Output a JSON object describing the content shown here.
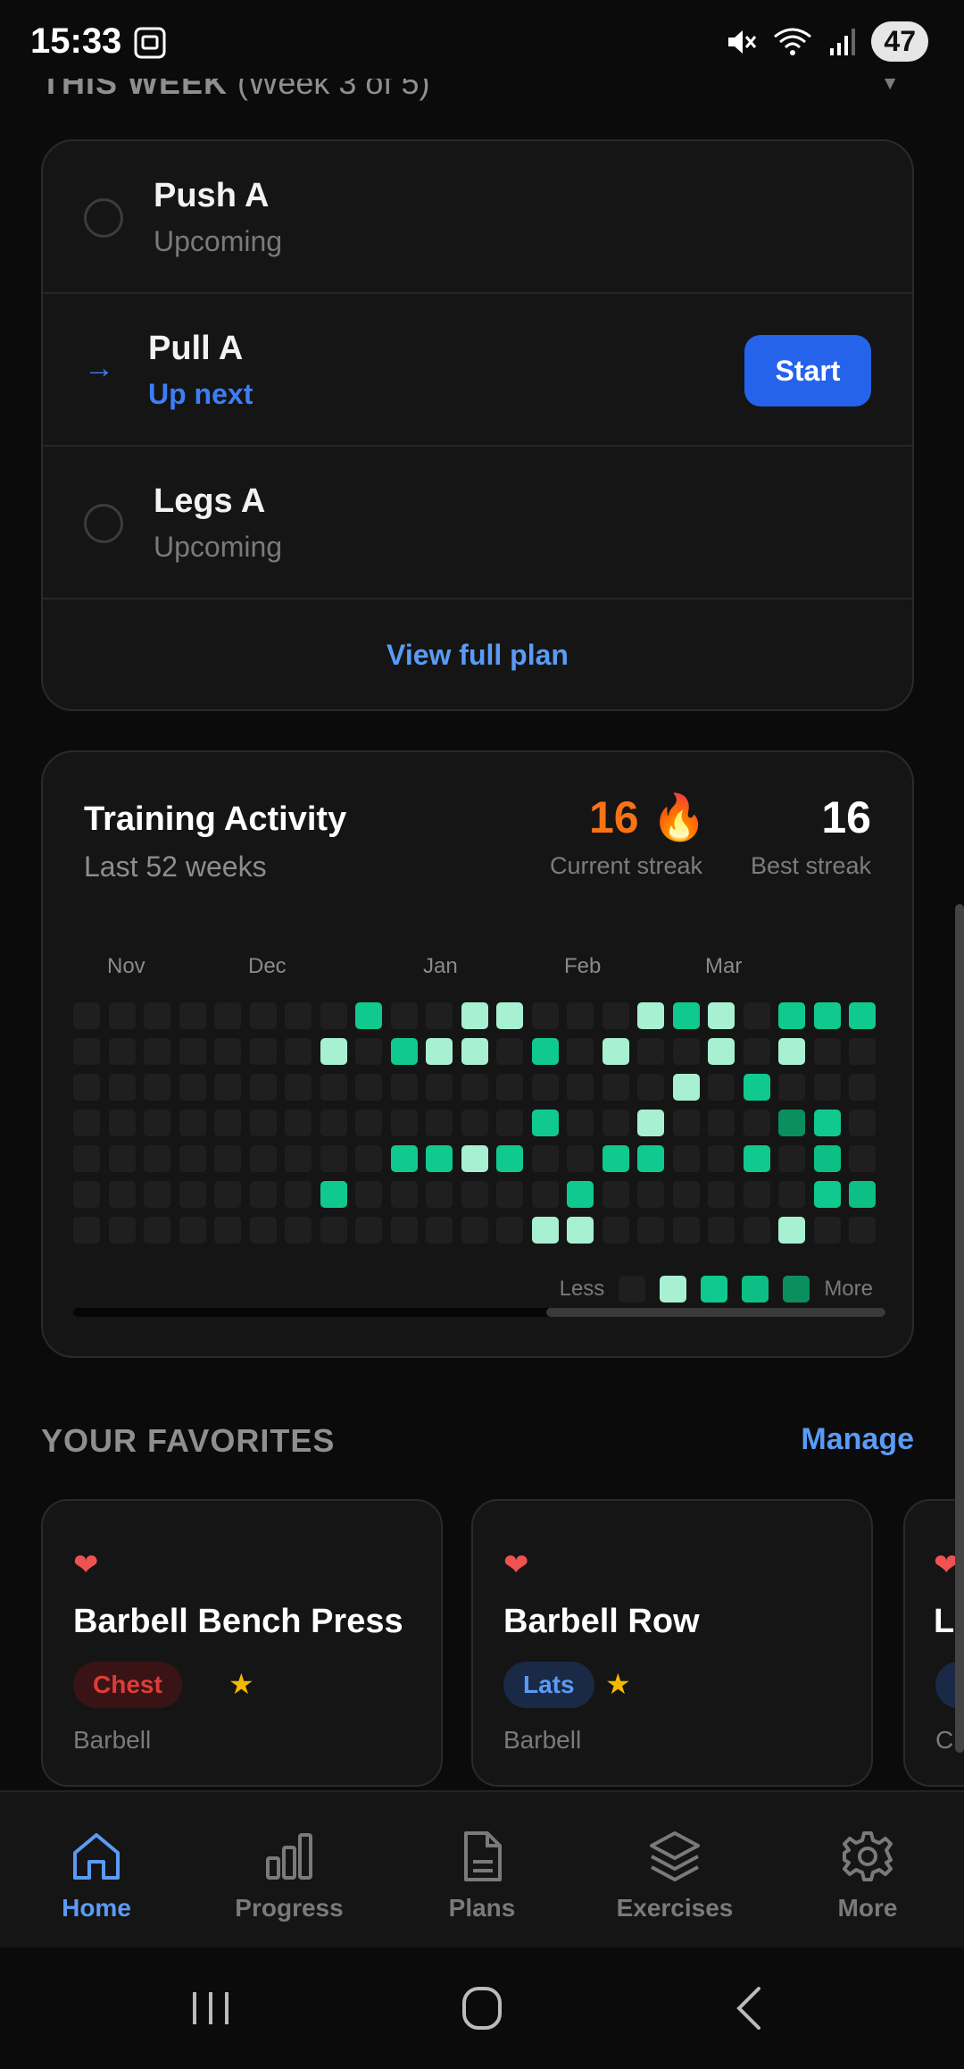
{
  "status_bar": {
    "time": "15:33",
    "battery": "47"
  },
  "week": {
    "title": "THIS WEEK",
    "subtitle": "(Week 3 of 5)"
  },
  "plan": {
    "rows": [
      {
        "title": "Push A",
        "status": "Upcoming"
      },
      {
        "title": "Pull A",
        "status": "Up next",
        "action": "Start"
      },
      {
        "title": "Legs A",
        "status": "Upcoming"
      }
    ],
    "view_full": "View full plan"
  },
  "activity": {
    "title": "Training Activity",
    "subtitle": "Last 52 weeks",
    "current_streak": "16",
    "current_streak_emoji": "🔥",
    "current_label": "Current streak",
    "best_streak": "16",
    "best_label": "Best streak",
    "months": [
      "Nov",
      "Dec",
      "Jan",
      "Feb",
      "Mar"
    ],
    "legend_less": "Less",
    "legend_more": "More",
    "colors": {
      "empty": "#1f1f1f",
      "l1": "#a7f0d1",
      "l2": "#10c98f",
      "l3": "#0cbf85",
      "l4": "#0b8f5f"
    },
    "heatmap": {
      "columns": 23,
      "rows": 7,
      "active": [
        {
          "col": 8,
          "row": 0,
          "level": 2
        },
        {
          "col": 11,
          "row": 0,
          "level": 1
        },
        {
          "col": 12,
          "row": 0,
          "level": 1
        },
        {
          "col": 16,
          "row": 0,
          "level": 1
        },
        {
          "col": 17,
          "row": 0,
          "level": 2
        },
        {
          "col": 18,
          "row": 0,
          "level": 1
        },
        {
          "col": 20,
          "row": 0,
          "level": 2
        },
        {
          "col": 21,
          "row": 0,
          "level": 2
        },
        {
          "col": 22,
          "row": 0,
          "level": 2
        },
        {
          "col": 7,
          "row": 1,
          "level": 1
        },
        {
          "col": 9,
          "row": 1,
          "level": 2
        },
        {
          "col": 10,
          "row": 1,
          "level": 1
        },
        {
          "col": 11,
          "row": 1,
          "level": 1
        },
        {
          "col": 13,
          "row": 1,
          "level": 2
        },
        {
          "col": 15,
          "row": 1,
          "level": 1
        },
        {
          "col": 18,
          "row": 1,
          "level": 1
        },
        {
          "col": 20,
          "row": 1,
          "level": 1
        },
        {
          "col": 17,
          "row": 2,
          "level": 1
        },
        {
          "col": 19,
          "row": 2,
          "level": 2
        },
        {
          "col": 13,
          "row": 3,
          "level": 2
        },
        {
          "col": 16,
          "row": 3,
          "level": 1
        },
        {
          "col": 20,
          "row": 3,
          "level": 4
        },
        {
          "col": 21,
          "row": 3,
          "level": 2
        },
        {
          "col": 9,
          "row": 4,
          "level": 2
        },
        {
          "col": 10,
          "row": 4,
          "level": 2
        },
        {
          "col": 11,
          "row": 4,
          "level": 1
        },
        {
          "col": 12,
          "row": 4,
          "level": 2
        },
        {
          "col": 15,
          "row": 4,
          "level": 2
        },
        {
          "col": 16,
          "row": 4,
          "level": 2
        },
        {
          "col": 19,
          "row": 4,
          "level": 2
        },
        {
          "col": 21,
          "row": 4,
          "level": 3
        },
        {
          "col": 7,
          "row": 5,
          "level": 2
        },
        {
          "col": 14,
          "row": 5,
          "level": 2
        },
        {
          "col": 21,
          "row": 5,
          "level": 2
        },
        {
          "col": 22,
          "row": 5,
          "level": 3
        },
        {
          "col": 13,
          "row": 6,
          "level": 1
        },
        {
          "col": 14,
          "row": 6,
          "level": 1
        },
        {
          "col": 20,
          "row": 6,
          "level": 1
        }
      ]
    }
  },
  "favorites": {
    "title": "YOUR FAVORITES",
    "manage": "Manage",
    "items": [
      {
        "name": "Barbell Bench Press",
        "tag": "Chest",
        "equipment": "Barbell"
      },
      {
        "name": "Barbell Row",
        "tag": "Lats",
        "equipment": "Barbell"
      },
      {
        "name": "L",
        "tag": "",
        "equipment": "C"
      }
    ]
  },
  "nav": {
    "items": [
      {
        "label": "Home",
        "icon": "home-icon",
        "active": true
      },
      {
        "label": "Progress",
        "icon": "bar-chart-icon"
      },
      {
        "label": "Plans",
        "icon": "document-icon"
      },
      {
        "label": "Exercises",
        "icon": "layers-icon"
      },
      {
        "label": "More",
        "icon": "gear-icon"
      }
    ]
  }
}
